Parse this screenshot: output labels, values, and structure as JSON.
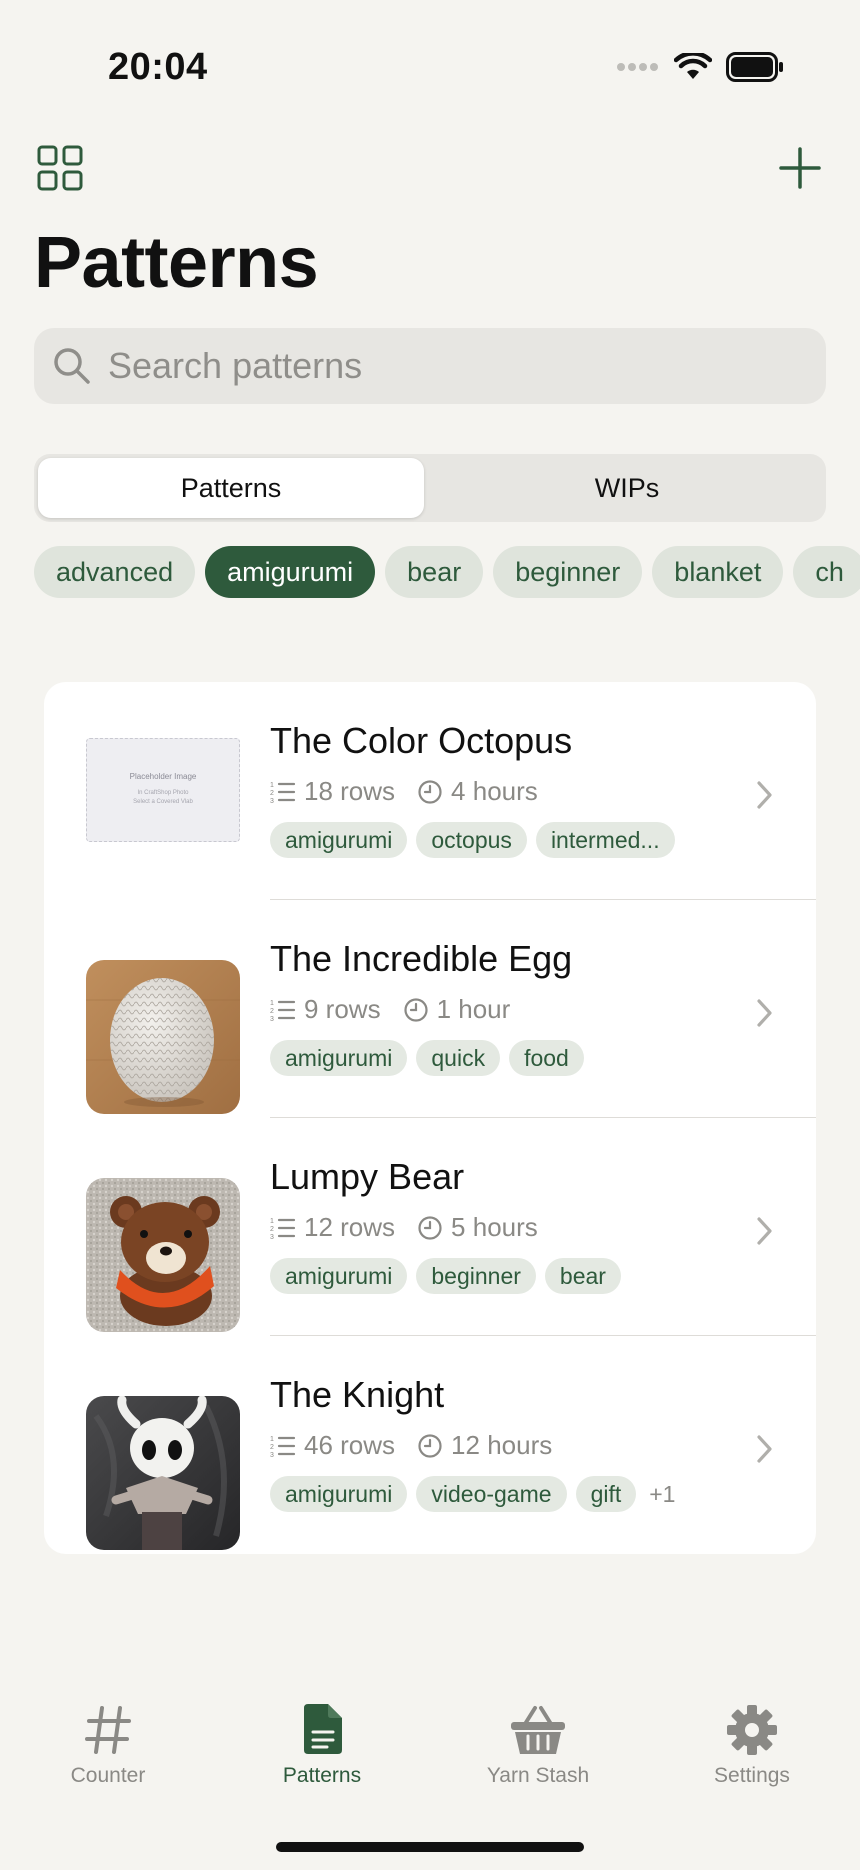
{
  "status": {
    "time": "20:04"
  },
  "header": {
    "title": "Patterns",
    "grid_icon": "grid-icon",
    "add_icon": "plus-icon"
  },
  "search": {
    "placeholder": "Search patterns"
  },
  "segments": {
    "patterns": "Patterns",
    "wips": "WIPs",
    "selected": "Patterns"
  },
  "chips": [
    "advanced",
    "amigurumi",
    "bear",
    "beginner",
    "blanket",
    "ch"
  ],
  "chips_selected": "amigurumi",
  "patterns": [
    {
      "title": "The Color Octopus",
      "rows": "18 rows",
      "time": "4 hours",
      "tags": [
        "amigurumi",
        "octopus",
        "intermed..."
      ],
      "more": "",
      "thumb": {
        "label": "Placeholder Image",
        "sub1": "In CraftShop Photo",
        "sub2": "Select a Covered Vlab"
      }
    },
    {
      "title": "The Incredible Egg",
      "rows": "9 rows",
      "time": "1 hour",
      "tags": [
        "amigurumi",
        "quick",
        "food"
      ],
      "more": ""
    },
    {
      "title": "Lumpy Bear",
      "rows": "12 rows",
      "time": "5 hours",
      "tags": [
        "amigurumi",
        "beginner",
        "bear"
      ],
      "more": ""
    },
    {
      "title": "The Knight",
      "rows": "46 rows",
      "time": "12 hours",
      "tags": [
        "amigurumi",
        "video-game",
        "gift"
      ],
      "more": "+1"
    }
  ],
  "tabs": [
    {
      "label": "Counter",
      "icon": "hash-icon"
    },
    {
      "label": "Patterns",
      "icon": "document-icon"
    },
    {
      "label": "Yarn Stash",
      "icon": "basket-icon"
    },
    {
      "label": "Settings",
      "icon": "gear-icon"
    }
  ],
  "active_tab": "Patterns",
  "colors": {
    "accent": "#2e5a3c",
    "background": "#f5f4f0",
    "chip_bg": "#dfe4dc",
    "secondary_text": "#8a8985"
  }
}
